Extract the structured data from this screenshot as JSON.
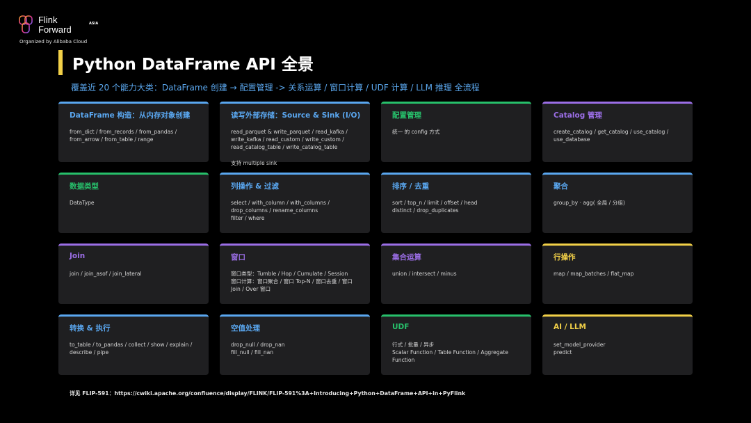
{
  "brand": {
    "word1": "Flink",
    "word2": "Forward",
    "asia": "ASIA",
    "organizer": "Organized by Alibaba Cloud"
  },
  "title": "Python DataFrame API 全景",
  "subtitle": "覆盖近 20 个能力大类：DataFrame 创建 → 配置管理 -> 关系运算 / 窗口计算 / UDF 计算 / LLM 推理 全流程",
  "colors": {
    "blue": "#5aa7f0",
    "green": "#27c06b",
    "purple": "#9b6ee6",
    "yellow": "#f2d048",
    "title_accent": "#f2d048"
  },
  "cards": [
    {
      "title": "DataFrame 构造：从内存对象创建",
      "body": "from_dict / from_records / from_pandas /\nfrom_arrow / from_table / range",
      "accent": "#5aa7f0"
    },
    {
      "title": "读写外部存储：Source & Sink (I/O)",
      "body": "read_parquet & write_parquet / read_kafka  /\nwrite_kafka / read_custom / write_custom  /\nread_catalog_table / write_catalog_table",
      "extra": "支持 multiple sink",
      "accent": "#5aa7f0"
    },
    {
      "title": "配置管理",
      "body": "统一 的 config 方式",
      "accent": "#27c06b"
    },
    {
      "title": "Catalog 管理",
      "body": "create_catalog / get_catalog / use_catalog /\nuse_database",
      "accent": "#9b6ee6"
    },
    {
      "title": "数据类型",
      "body": "DataType",
      "accent": "#27c06b"
    },
    {
      "title": "列操作 & 过滤",
      "body": "select / with_column / with_columns /\ndrop_columns / rename_columns\nfilter / where",
      "accent": "#5aa7f0"
    },
    {
      "title": "排序 / 去重",
      "body": "sort / top_n / limit / offset / head\ndistinct / drop_duplicates",
      "accent": "#5aa7f0"
    },
    {
      "title": "聚合",
      "body": "group_by · agg( 全局 / 分组)",
      "accent": "#5aa7f0"
    },
    {
      "title": "Join",
      "body": "join / join_asof / join_lateral",
      "accent": "#9b6ee6"
    },
    {
      "title": "窗口",
      "body": "窗口类型：Tumble / Hop / Cumulate / Session\n窗口计算：窗口聚合 / 窗口 Top-N / 窗口去重 / 窗口\nJoin / Over 窗口",
      "accent": "#9b6ee6"
    },
    {
      "title": "集合运算",
      "body": "union / intersect / minus",
      "accent": "#9b6ee6"
    },
    {
      "title": "行操作",
      "body": "map / map_batches / flat_map",
      "accent": "#f2d048"
    },
    {
      "title": "转换 & 执行",
      "body": "to_table / to_pandas / collect / show / explain /\ndescribe / pipe",
      "accent": "#5aa7f0"
    },
    {
      "title": "空值处理",
      "body": "drop_null / drop_nan\nfill_null / fill_nan",
      "accent": "#5aa7f0"
    },
    {
      "title": "UDF",
      "body": "行式 / 批量 / 异步\nScalar Function / Table Function / Aggregate\nFunction",
      "accent": "#27c06b"
    },
    {
      "title": "AI / LLM",
      "body": "set_model_provider\npredict",
      "accent": "#f2d048"
    }
  ],
  "footer": "详见 FLIP-591：https://cwiki.apache.org/confluence/display/FLINK/FLIP-591%3A+Introducing+Python+DataFrame+API+in+PyFlink"
}
